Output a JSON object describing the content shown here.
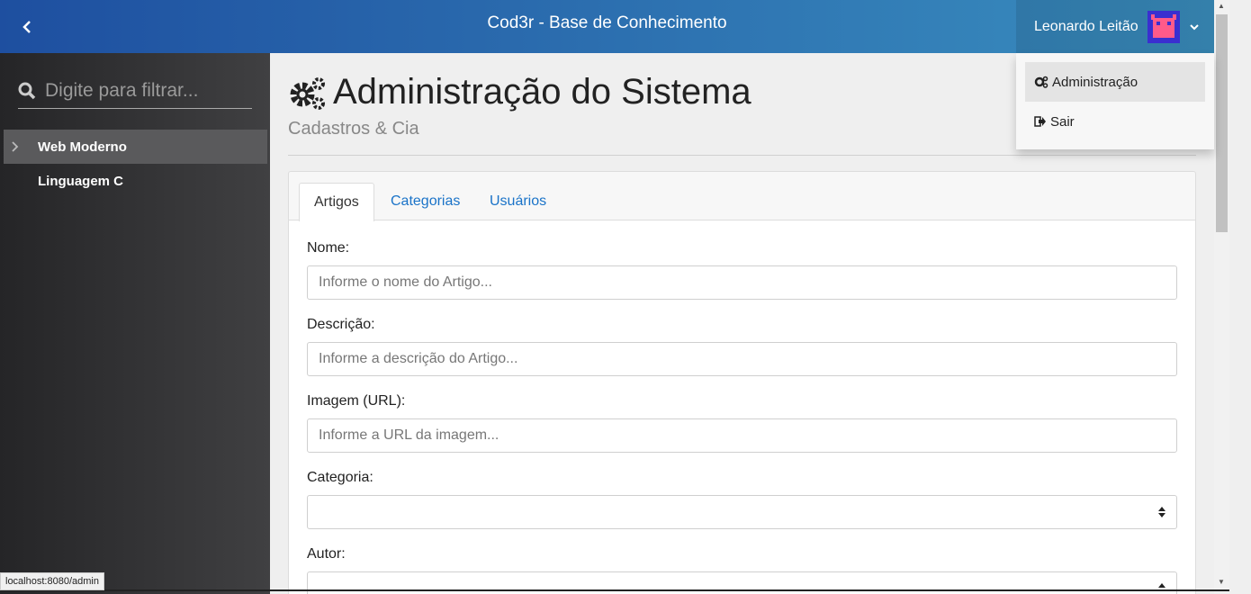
{
  "header": {
    "title": "Cod3r - Base de Conhecimento",
    "user_name": "Leonardo Leitão"
  },
  "user_dropdown": {
    "items": [
      {
        "label": "Administração",
        "icon": "cogs-icon"
      },
      {
        "label": "Sair",
        "icon": "sign-out-icon"
      }
    ]
  },
  "sidebar": {
    "search_placeholder": "Digite para filtrar...",
    "tree": [
      {
        "label": "Web Moderno",
        "selected": true
      },
      {
        "label": "Linguagem C",
        "selected": false
      }
    ]
  },
  "main": {
    "title": "Administração do Sistema",
    "subtitle": "Cadastros & Cia",
    "tabs": [
      {
        "label": "Artigos",
        "active": true
      },
      {
        "label": "Categorias",
        "active": false
      },
      {
        "label": "Usuários",
        "active": false
      }
    ],
    "form": {
      "name_label": "Nome:",
      "name_placeholder": "Informe o nome do Artigo...",
      "description_label": "Descrição:",
      "description_placeholder": "Informe a descrição do Artigo...",
      "image_label": "Imagem (URL):",
      "image_placeholder": "Informe a URL da imagem...",
      "category_label": "Categoria:",
      "author_label": "Autor:"
    }
  },
  "status_bar": {
    "url": "localhost:8080/admin"
  },
  "colors": {
    "header_start": "#1e4fa0",
    "header_end": "#3a8fbf",
    "link": "#1a73c8",
    "avatar": "#3a2fd0"
  }
}
